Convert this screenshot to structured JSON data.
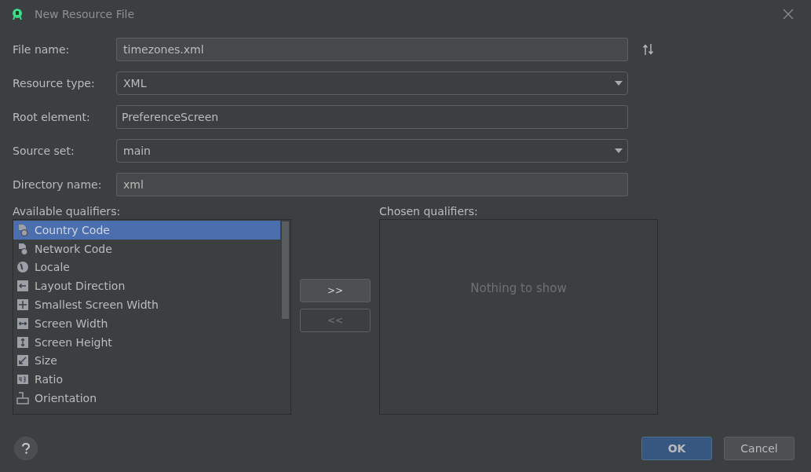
{
  "window": {
    "title": "New Resource File"
  },
  "form": [
    {
      "label": "File name:",
      "kind": "text",
      "value": "timezones.xml"
    },
    {
      "label": "Resource type:",
      "kind": "dropdown",
      "value": "XML"
    },
    {
      "label": "Root element:",
      "kind": "combo",
      "value": "PreferenceScreen"
    },
    {
      "label": "Source set:",
      "kind": "dropdown",
      "value": "main"
    },
    {
      "label": "Directory name:",
      "kind": "text",
      "value": "xml"
    }
  ],
  "available_qualifiers": {
    "label": "Available qualifiers:",
    "items": [
      {
        "name": "Country Code",
        "selected": true
      },
      {
        "name": "Network Code",
        "selected": false
      },
      {
        "name": "Locale",
        "selected": false
      },
      {
        "name": "Layout Direction",
        "selected": false
      },
      {
        "name": "Smallest Screen Width",
        "selected": false
      },
      {
        "name": "Screen Width",
        "selected": false
      },
      {
        "name": "Screen Height",
        "selected": false
      },
      {
        "name": "Size",
        "selected": false
      },
      {
        "name": "Ratio",
        "selected": false
      },
      {
        "name": "Orientation",
        "selected": false
      }
    ]
  },
  "move_buttons": [
    {
      "label": ">>",
      "disabled": false
    },
    {
      "label": "<<",
      "disabled": true
    }
  ],
  "chosen_qualifiers": {
    "label": "Chosen qualifiers:",
    "empty_text": "Nothing to show"
  },
  "buttons": [
    {
      "label": "OK",
      "kind": "primary"
    },
    {
      "label": "Cancel",
      "kind": "secondary"
    }
  ]
}
